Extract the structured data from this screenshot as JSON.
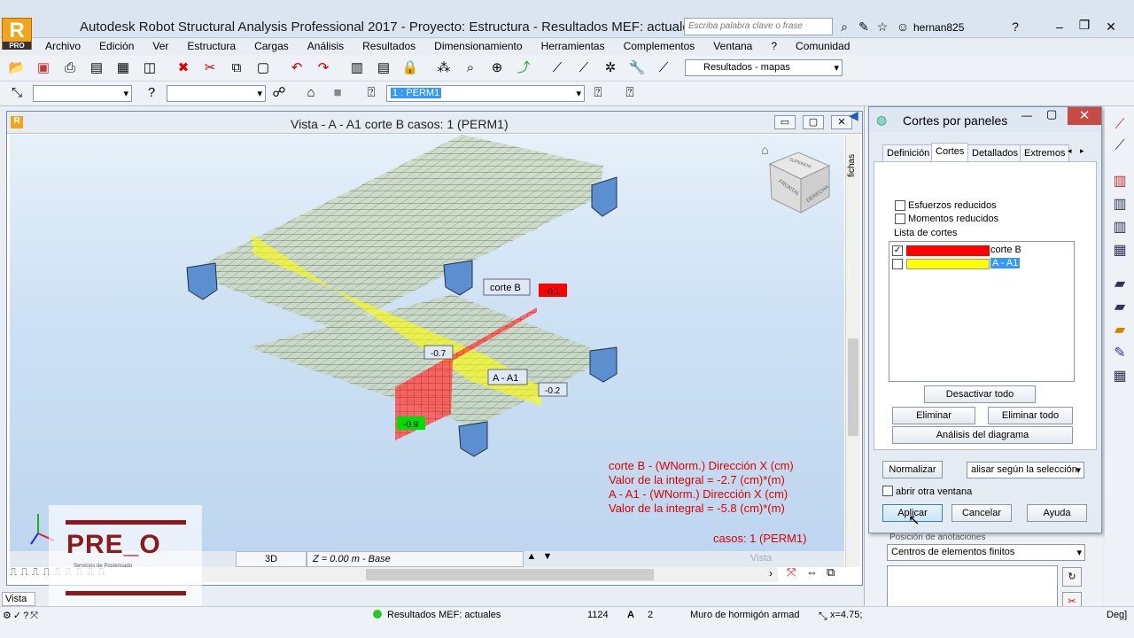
{
  "app": {
    "title": "Autodesk Robot Structural Analysis Professional 2017 - Proyecto: Estructura - Resultados MEF: actuales",
    "logo_letter": "R",
    "logo_sub": "PRO",
    "search_placeholder": "Escriba palabra clave o frase",
    "user": "hernan825"
  },
  "menu": [
    "Archivo",
    "Edición",
    "Ver",
    "Estructura",
    "Cargas",
    "Análisis",
    "Resultados",
    "Dimensionamiento",
    "Herramientas",
    "Complementos",
    "Ventana",
    "?",
    "Comunidad"
  ],
  "toolbar": {
    "layout_combo": "Resultados - mapas",
    "case_combo": "1 : PERM1"
  },
  "view": {
    "title": "Vista  -  A - A1 corte B casos: 1 (PERM1)",
    "labels": {
      "corte_b": "corte B",
      "a_a1": "A - A1",
      "v1": "-0.1",
      "v2": "-0.7",
      "v3": "-0.2",
      "v4": "-0.9"
    },
    "result_lines": [
      "corte B - (WNorm.) Dirección X (cm)",
      "Valor de la integral = -2.7 (cm)*(m)",
      "A - A1 - (WNorm.) Dirección X (cm)",
      "Valor de la integral = -5.8 (cm)*(m)"
    ],
    "cases": "casos: 1 (PERM1)",
    "bottom_mode": "3D",
    "bottom_level": "Z = 0.00 m - Base",
    "bottom_vista": "Vista",
    "cube_top": "SUPERIOR",
    "cube_front": "FRONTAL",
    "cube_right": "DERECHA"
  },
  "fichas": "fichas",
  "dialog": {
    "title": "Cortes por paneles",
    "tabs": [
      "Definición",
      "Cortes",
      "Detallados",
      "Extremos"
    ],
    "check_esfuerzos": "Esfuerzos reducidos",
    "check_momentos": "Momentos reducidos",
    "list_label": "Lista de cortes",
    "list": [
      {
        "name": "corte B",
        "color": "#ff0000",
        "checked": true
      },
      {
        "name": "A - A1",
        "color": "#ffff00",
        "checked": false
      }
    ],
    "btn_desactivar": "Desactivar todo",
    "btn_eliminar": "Eliminar",
    "btn_eliminar_todo": "Eliminar todo",
    "btn_analisis": "Análisis del diagrama",
    "btn_normalizar": "Normalizar",
    "combo_alisar": "alisar según la selección",
    "check_abrir": "abrir otra ventana",
    "btn_aplicar": "Aplicar",
    "btn_cancelar": "Cancelar",
    "btn_ayuda": "Ayuda"
  },
  "right_panel": {
    "posicion_label": "Posición de anotaciones",
    "combo_centros": "Centros de elementos finitos"
  },
  "status": {
    "vista": "Vista",
    "results": "Resultados MEF: actuales",
    "num1": "1124",
    "num2": "2",
    "element": "Muro de hormigón armad",
    "coord": "x=4.75;",
    "deg": "Deg]"
  },
  "watermark": {
    "brand": "PRE_O",
    "sub": "Servicios de Postensado"
  },
  "colors": {
    "red": "#ff0000",
    "yellow": "#ffff00",
    "green": "#00dd00",
    "result_text": "#e00000",
    "mesh": "#3a4a2a"
  }
}
